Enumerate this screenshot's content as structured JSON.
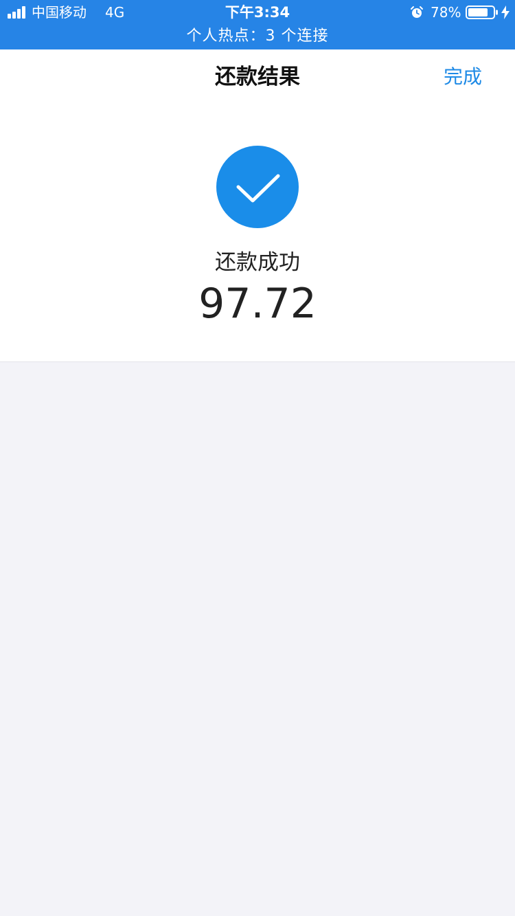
{
  "status_bar": {
    "carrier": "中国移动",
    "network": "4G",
    "time": "下午3:34",
    "battery_percent": "78%",
    "hotspot": "个人热点：3 个连接"
  },
  "nav": {
    "title": "还款结果",
    "done_label": "完成"
  },
  "result": {
    "status_text": "还款成功",
    "amount": "97.72"
  },
  "icons": {
    "signal": "signal-bars-icon",
    "alarm": "alarm-icon",
    "battery": "battery-icon",
    "charging": "charging-bolt-icon",
    "success": "check-circle-icon"
  },
  "colors": {
    "status_bar_bg": "#2684e6",
    "accent": "#1e8ae6",
    "success_circle": "#1a8de9",
    "page_bg": "#f3f3f8"
  }
}
